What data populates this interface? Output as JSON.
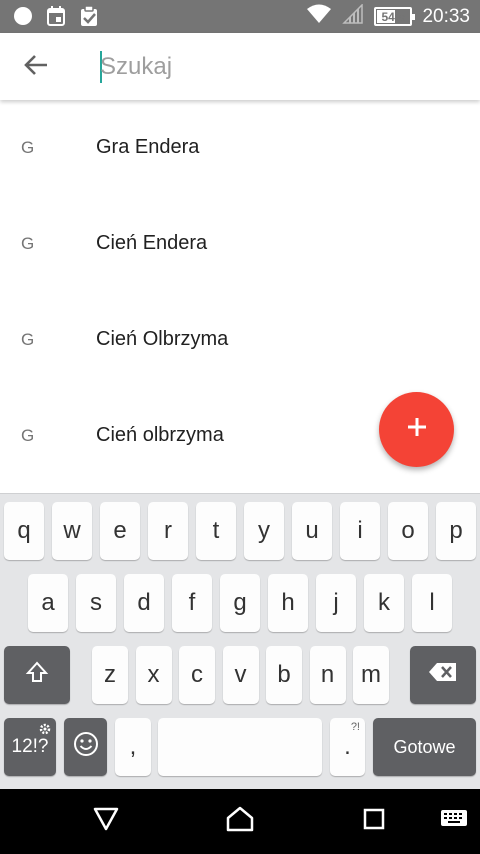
{
  "status_bar": {
    "time": "20:33",
    "battery_percent": 54,
    "battery_text": "54%",
    "icons": [
      "circle-icon",
      "calendar-icon",
      "clipboard-check-icon",
      "wifi-icon",
      "signal-icon"
    ]
  },
  "search": {
    "placeholder": "Szukaj",
    "value": ""
  },
  "results": [
    {
      "letter": "G",
      "title": "Gra Endera"
    },
    {
      "letter": "G",
      "title": "Cień Endera"
    },
    {
      "letter": "G",
      "title": "Cień Olbrzyma"
    },
    {
      "letter": "G",
      "title": "Cień olbrzyma"
    }
  ],
  "fab": {
    "label": "+",
    "color": "#f44336"
  },
  "keyboard": {
    "row1": [
      "q",
      "w",
      "e",
      "r",
      "t",
      "y",
      "u",
      "i",
      "o",
      "p"
    ],
    "row2": [
      "a",
      "s",
      "d",
      "f",
      "g",
      "h",
      "j",
      "k",
      "l"
    ],
    "row3": [
      "z",
      "x",
      "c",
      "v",
      "b",
      "n",
      "m"
    ],
    "symbols_label": "12!?",
    "comma_label": ",",
    "period_label": ".",
    "period_sub": "?!",
    "done_label": "Gotowe"
  },
  "colors": {
    "status_bar": "#757575",
    "accent": "#26a69a",
    "fab": "#f44336",
    "nav_bar": "#000000"
  }
}
